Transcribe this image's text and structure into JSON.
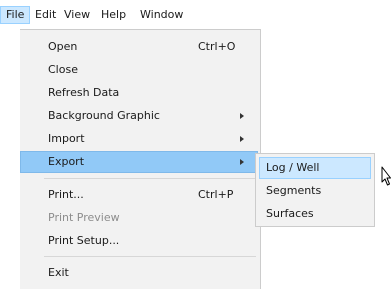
{
  "menubar": {
    "items": [
      {
        "label": "File",
        "open": true
      },
      {
        "label": "Edit"
      },
      {
        "label": "View"
      },
      {
        "label": "Help"
      },
      {
        "label": "Window"
      }
    ]
  },
  "file_menu": {
    "items": [
      {
        "label": "Open",
        "shortcut": "Ctrl+O"
      },
      {
        "label": "Close"
      },
      {
        "label": "Refresh Data"
      },
      {
        "label": "Background Graphic",
        "has_submenu": true
      },
      {
        "label": "Import",
        "has_submenu": true
      },
      {
        "label": "Export",
        "has_submenu": true,
        "highlighted": true
      },
      {
        "label": "Print...",
        "shortcut": "Ctrl+P"
      },
      {
        "label": "Print Preview",
        "disabled": true
      },
      {
        "label": "Print Setup..."
      },
      {
        "label": "Exit"
      }
    ]
  },
  "export_submenu": {
    "items": [
      {
        "label": "Log / Well",
        "highlighted": true
      },
      {
        "label": "Segments"
      },
      {
        "label": "Surfaces"
      }
    ]
  },
  "colors": {
    "menu_background": "#f2f2f2",
    "highlight": "#91c9f7",
    "menubar_open": "#cce8ff",
    "disabled_text": "#8d8d8d"
  }
}
